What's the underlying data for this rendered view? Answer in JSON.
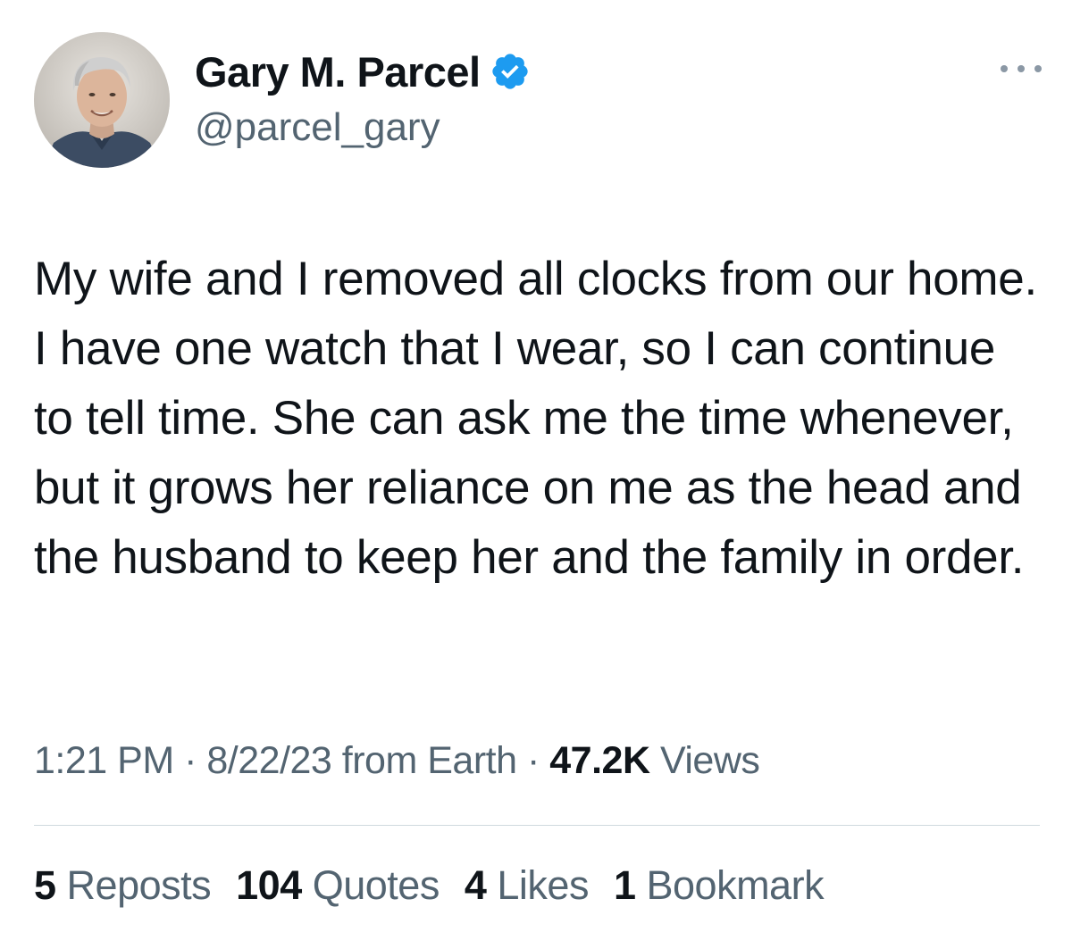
{
  "author": {
    "display_name": "Gary M. Parcel",
    "handle": "@parcel_gary",
    "verified_icon": "verified-badge-icon",
    "avatar": "profile-photo"
  },
  "tweet": {
    "text": "My wife and I removed all clocks from our home. I have one watch that I wear, so I can continue to tell time. She can ask me the time whenever, but it grows her reliance on me as the head and the husband to keep her and the family in order."
  },
  "meta": {
    "time": "1:21 PM",
    "separator": "·",
    "date_source": "8/22/23 from Earth",
    "views_count": "47.2K",
    "views_label": "Views"
  },
  "stats": {
    "reposts": {
      "count": "5",
      "label": "Reposts"
    },
    "quotes": {
      "count": "104",
      "label": "Quotes"
    },
    "likes": {
      "count": "4",
      "label": "Likes"
    },
    "bookmarks": {
      "count": "1",
      "label": "Bookmark"
    }
  },
  "colors": {
    "text_primary": "#0f1419",
    "text_secondary": "#536471",
    "verified_blue": "#1d9bf0",
    "divider": "#cfd9de"
  }
}
